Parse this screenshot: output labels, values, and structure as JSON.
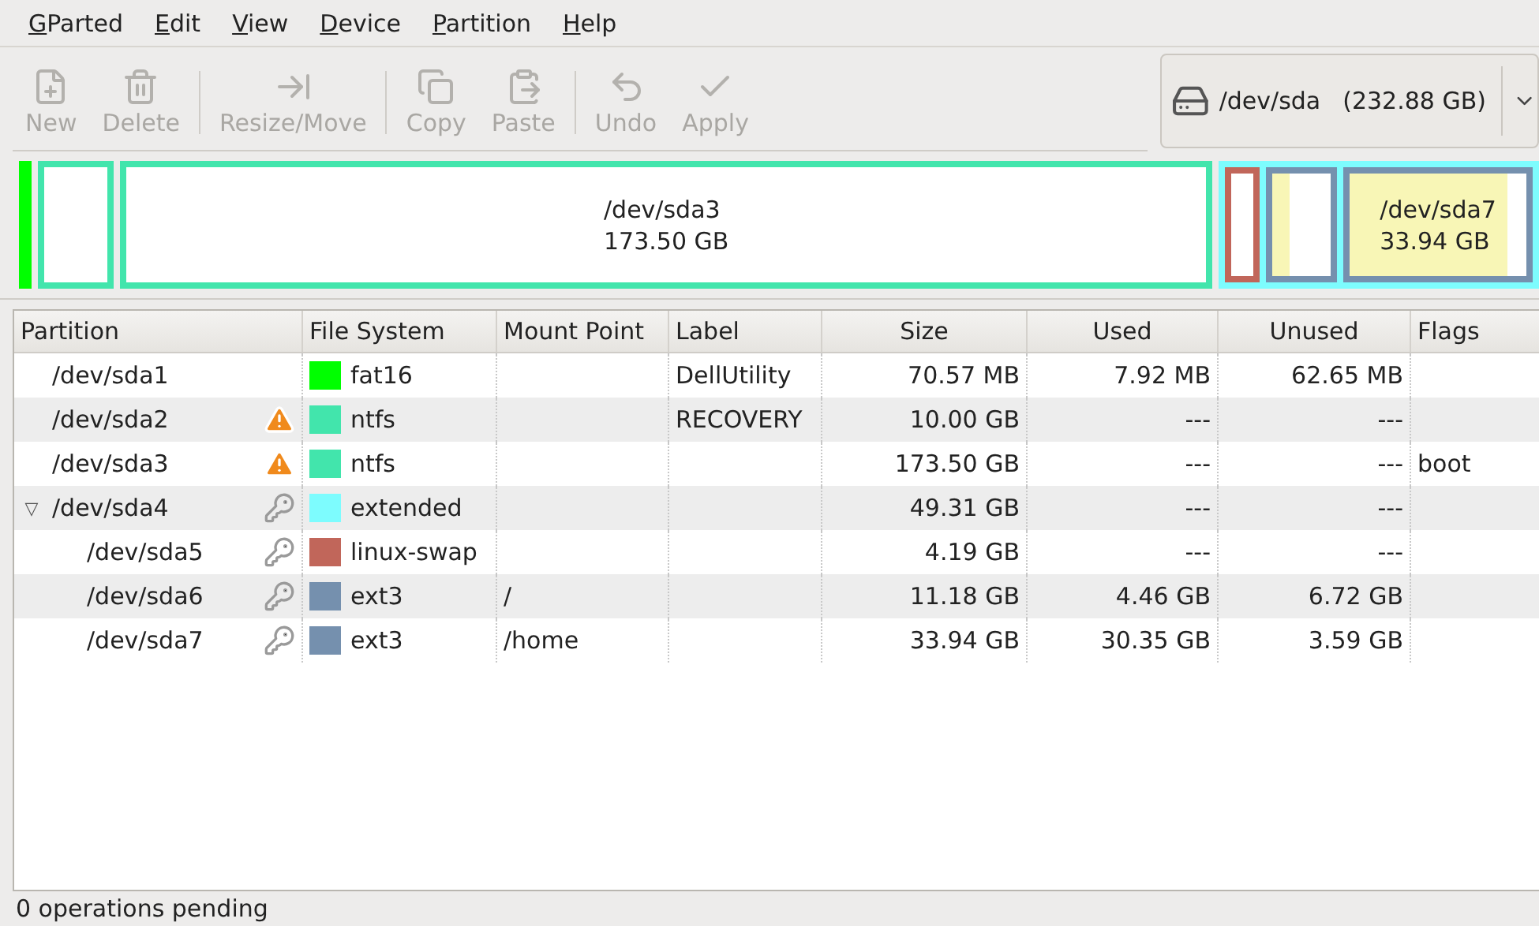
{
  "menu": [
    {
      "label": "GParted"
    },
    {
      "label": "Edit"
    },
    {
      "label": "View"
    },
    {
      "label": "Device"
    },
    {
      "label": "Partition"
    },
    {
      "label": "Help"
    }
  ],
  "toolbar": [
    {
      "kind": "button",
      "label": "New",
      "disabled": true
    },
    {
      "kind": "button",
      "label": "Delete",
      "disabled": true
    },
    {
      "kind": "separator"
    },
    {
      "kind": "button",
      "label": "Resize/Move",
      "disabled": true
    },
    {
      "kind": "separator"
    },
    {
      "kind": "button",
      "label": "Copy",
      "disabled": true
    },
    {
      "kind": "button",
      "label": "Paste",
      "disabled": true
    },
    {
      "kind": "separator"
    },
    {
      "kind": "button",
      "label": "Undo",
      "disabled": true
    },
    {
      "kind": "button",
      "label": "Apply",
      "disabled": true
    }
  ],
  "device": {
    "name": "/dev/sda",
    "size": "(232.88 GB)"
  },
  "disk_map": [
    {
      "color": "#00ff00"
    },
    {
      "color": "#42e5ac"
    },
    {
      "color": "#42e5ac",
      "name": "/dev/sda3",
      "size": "173.50 GB"
    },
    {
      "color": "#7dfcfe",
      "children": [
        {
          "color": "#c1665a"
        },
        {
          "color": "#7590ae"
        },
        {
          "color": "#7590ae",
          "name": "/dev/sda7",
          "size": "33.94 GB"
        }
      ]
    }
  ],
  "table": {
    "columns": [
      "Partition",
      "File System",
      "Mount Point",
      "Label",
      "Size",
      "Used",
      "Unused",
      "Flags"
    ],
    "rows": [
      {
        "partition": "/dev/sda1",
        "kind": "plain",
        "color": "#00ff00",
        "file_system": "fat16",
        "label": "DellUtility",
        "size": "70.57 MB",
        "used": "7.92 MB",
        "unused": "62.65 MB"
      },
      {
        "partition": "/dev/sda2",
        "kind": "warning",
        "color": "#42e5ac",
        "file_system": "ntfs",
        "label": "RECOVERY",
        "size": "10.00 GB",
        "used": "---",
        "unused": "---"
      },
      {
        "partition": "/dev/sda3",
        "kind": "warning",
        "color": "#42e5ac",
        "file_system": "ntfs",
        "size": "173.50 GB",
        "used": "---",
        "unused": "---",
        "flags": "boot"
      },
      {
        "partition": "/dev/sda4",
        "kind": "locked",
        "color": "#7dfcfe",
        "file_system": "extended",
        "size": "49.31 GB",
        "used": "---",
        "unused": "---",
        "expander": "▽",
        "expanded": true,
        "children": [
          {
            "partition": "/dev/sda5",
            "kind": "locked",
            "color": "#c1665a",
            "file_system": "linux-swap",
            "size": "4.19 GB",
            "used": "---",
            "unused": "---"
          },
          {
            "partition": "/dev/sda6",
            "kind": "locked",
            "color": "#7590ae",
            "file_system": "ext3",
            "mount_point": "/",
            "size": "11.18 GB",
            "used": "4.46 GB",
            "unused": "6.72 GB"
          },
          {
            "partition": "/dev/sda7",
            "kind": "locked",
            "color": "#7590ae",
            "file_system": "ext3",
            "mount_point": "/home",
            "size": "33.94 GB",
            "used": "30.35 GB",
            "unused": "3.59 GB"
          }
        ]
      }
    ]
  },
  "status_bar": "0 operations pending"
}
